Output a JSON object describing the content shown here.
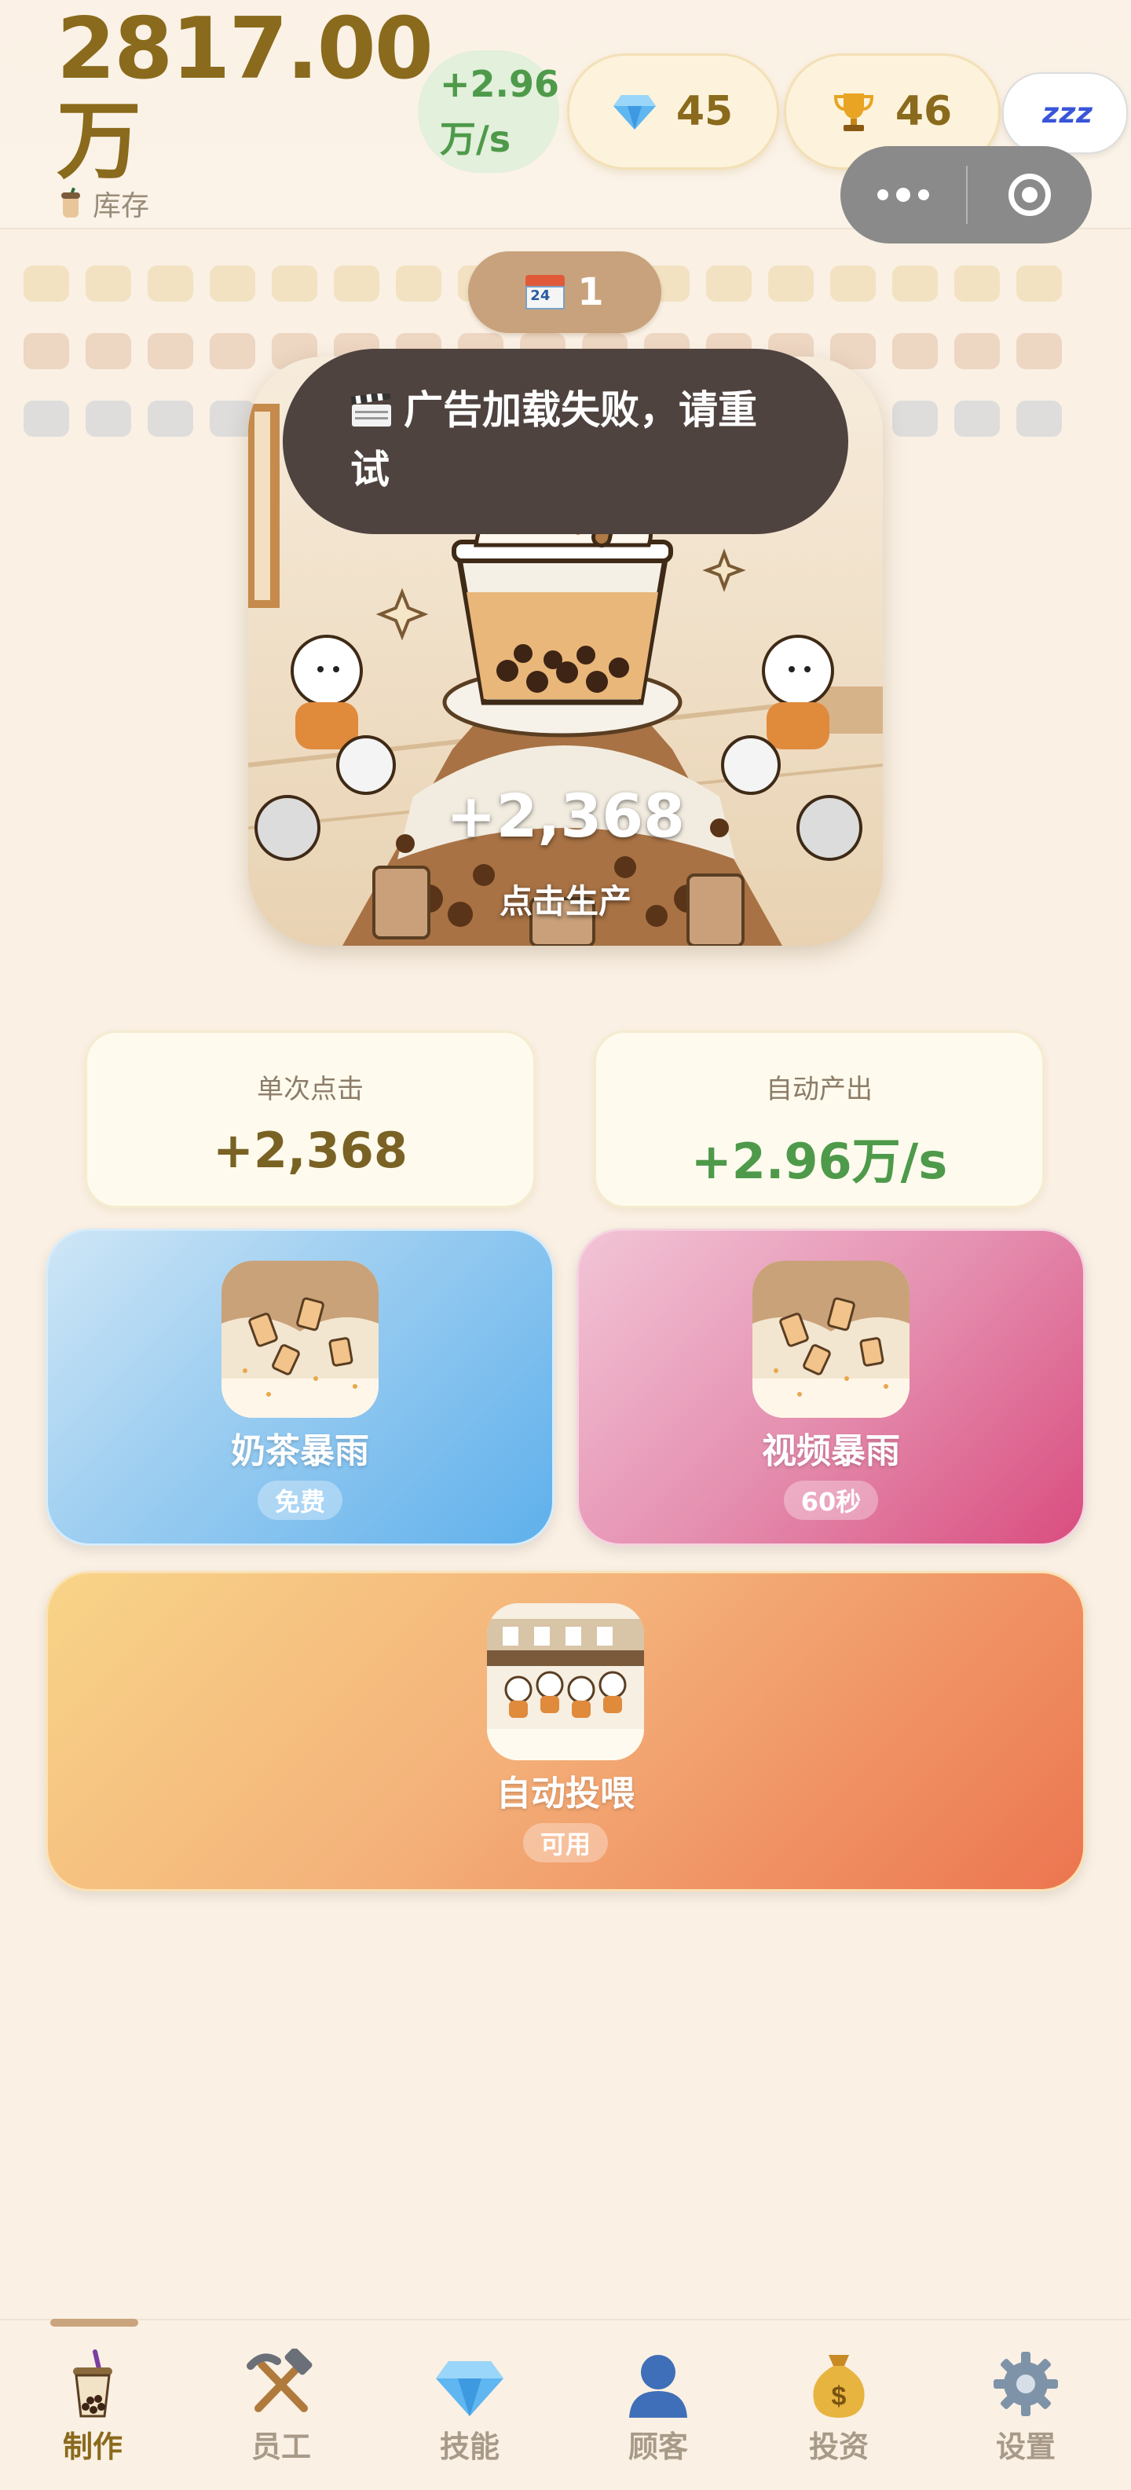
{
  "header": {
    "stock_value": "2817.00万",
    "stock_label": "库存",
    "rate": "+2.96万/s",
    "gems": "45",
    "trophies": "46",
    "sleep_symbol": "z z z"
  },
  "shop": {
    "level": "1"
  },
  "toast": {
    "message": "广告加载失败，请重试"
  },
  "tap_card": {
    "value": "+2,368",
    "hint": "点击生产"
  },
  "stats": {
    "click": {
      "label": "单次点击",
      "value": "+2,368"
    },
    "auto": {
      "label": "自动产出",
      "value": "+2.96万/s"
    }
  },
  "actions": {
    "rain_free": {
      "title": "奶茶暴雨",
      "tag": "免费"
    },
    "rain_video": {
      "title": "视频暴雨",
      "tag": "60秒"
    },
    "auto_feed": {
      "title": "自动投喂",
      "tag": "可用"
    }
  },
  "nav": [
    {
      "label": "制作",
      "icon": "milk-tea-icon",
      "active": true
    },
    {
      "label": "员工",
      "icon": "hammer-pick-icon"
    },
    {
      "label": "技能",
      "icon": "gem-icon"
    },
    {
      "label": "顾客",
      "icon": "person-icon"
    },
    {
      "label": "投资",
      "icon": "money-bag-icon"
    },
    {
      "label": "设置",
      "icon": "gear-icon"
    }
  ],
  "colors": {
    "accent_gold": "#8a6a1c",
    "accent_green": "#4e9a4a",
    "toast_bg": "#4f4340",
    "background": "#faf0e4"
  }
}
